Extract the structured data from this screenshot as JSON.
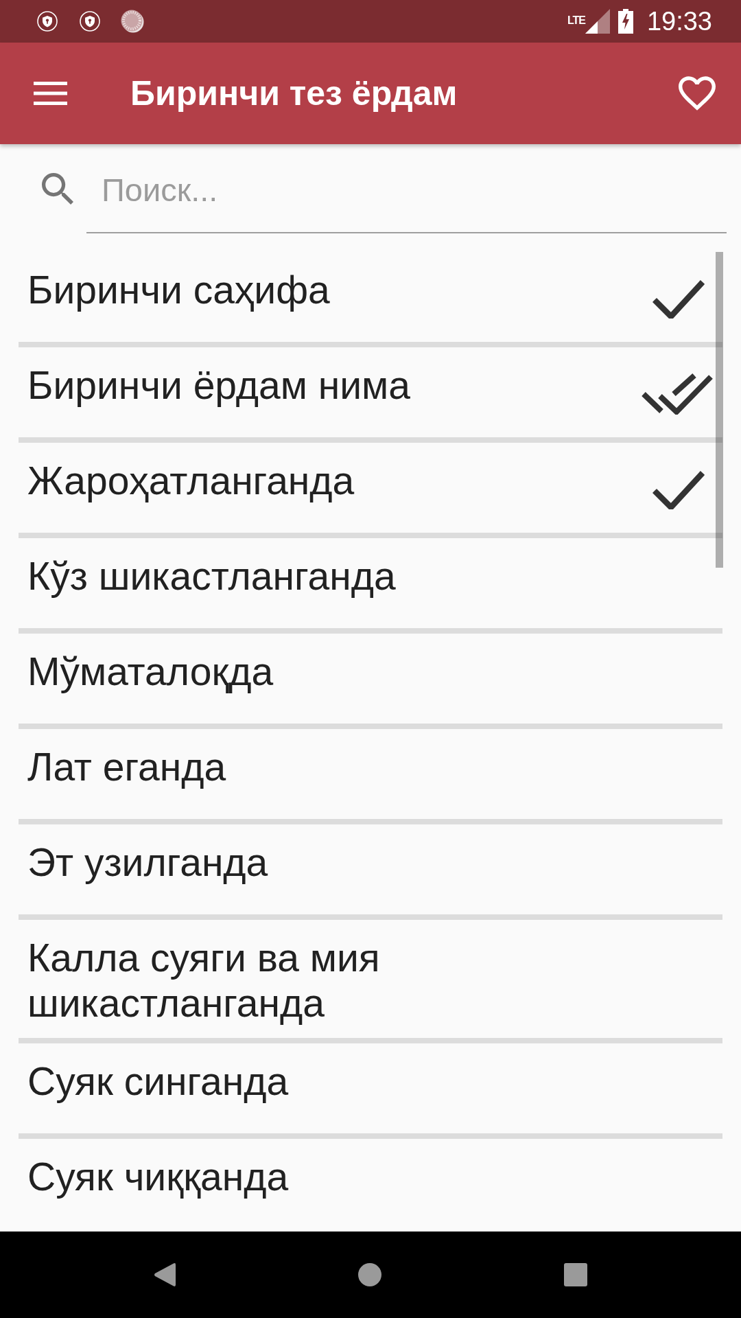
{
  "status_bar": {
    "network": "LTE",
    "time": "19:33"
  },
  "app_bar": {
    "title": "Биринчи тез ёрдам"
  },
  "search": {
    "placeholder": "Поиск..."
  },
  "items": [
    {
      "label": "Биринчи саҳифа",
      "checked": true,
      "double": false
    },
    {
      "label": "Биринчи ёрдам нима",
      "checked": true,
      "double": true
    },
    {
      "label": "Жароҳатланганда",
      "checked": true,
      "double": false
    },
    {
      "label": "Кўз шикастланганда",
      "checked": false,
      "double": false
    },
    {
      "label": "Мўматалоқда",
      "checked": false,
      "double": false
    },
    {
      "label": "Лат еганда",
      "checked": false,
      "double": false
    },
    {
      "label": "Эт узилганда",
      "checked": false,
      "double": false
    },
    {
      "label": "Калла суяги ва мия шикастланганда",
      "checked": false,
      "double": false
    },
    {
      "label": "Суяк синганда",
      "checked": false,
      "double": false
    },
    {
      "label": "Суяк чиққанда",
      "checked": false,
      "double": false
    }
  ]
}
